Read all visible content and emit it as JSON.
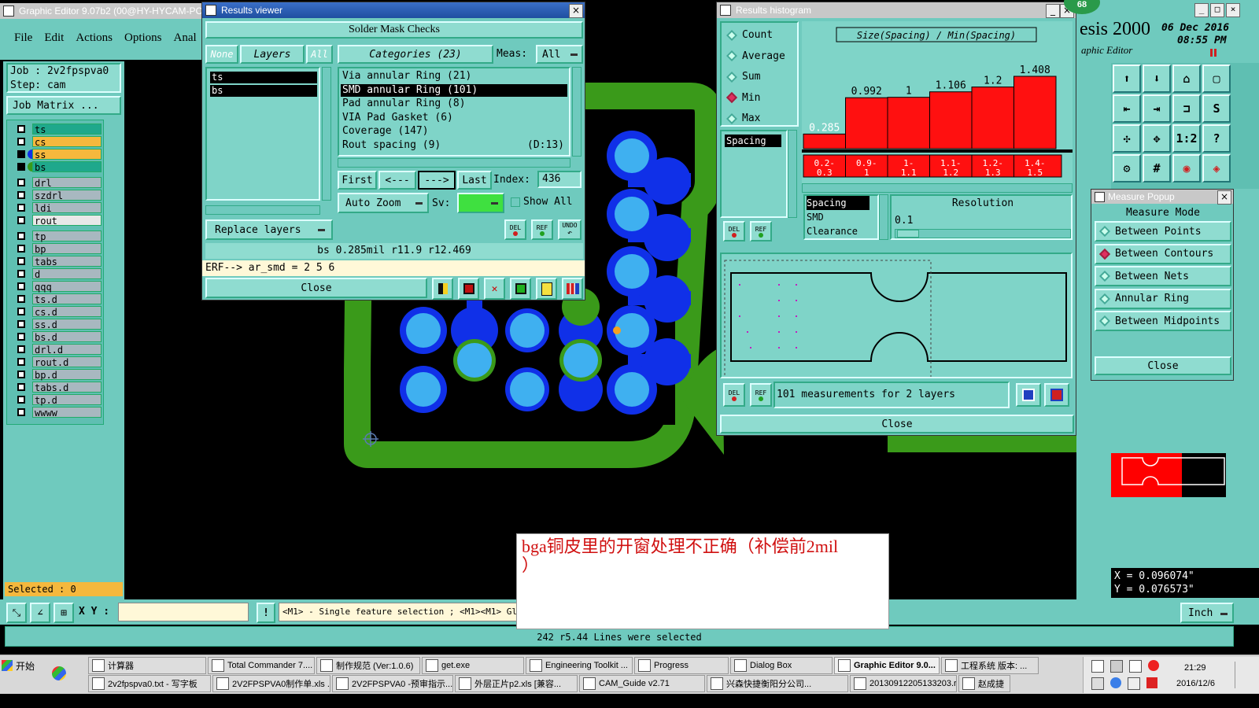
{
  "main_window": {
    "title": "Graphic Editor 9.07b2 (00@HY-HYCAM-PC",
    "menu": [
      "File",
      "Edit",
      "Actions",
      "Options",
      "Anal"
    ],
    "job_label": "Job : 2v2fpspva0",
    "step_label": "Step: cam",
    "job_matrix_button": "Job Matrix ...",
    "selected_label": "Selected : 0",
    "coord_label": "X Y :",
    "status_hint": "<M1> - Single feature selection ; <M1><M1> Gl",
    "units_button": "Inch",
    "status_bar": "242 r5.44 Lines were selected",
    "brand": "esis 2000",
    "brand_sub": "aphic Editor",
    "date": "06 Dec 2016",
    "time": "08:55 PM",
    "coord_x": "X = 0.096074\"",
    "coord_y": "Y = 0.076573\"",
    "badge": "68"
  },
  "layers_group1": [
    {
      "name": "ts",
      "color": "#1fa88c"
    },
    {
      "name": "cs",
      "color": "#f5b83d"
    },
    {
      "name": "ss",
      "color": "#f5b83d"
    },
    {
      "name": "bs",
      "color": "#1fa88c"
    }
  ],
  "layers_group2": [
    "drl",
    "szdrl",
    "ldi",
    "rout"
  ],
  "layers_group3": [
    "tp",
    "bp",
    "tabs",
    "d",
    "qqq",
    "ts.d",
    "cs.d",
    "ss.d",
    "bs.d",
    "drl.d",
    "rout.d",
    "bp.d",
    "tabs.d",
    "tp.d",
    "wwww"
  ],
  "results_viewer": {
    "title": "Results viewer",
    "heading": "Solder Mask Checks",
    "none_btn": "None",
    "layers_btn": "Layers",
    "all_btn": "All",
    "categories_label": "Categories (23)",
    "meas_label": "Meas:",
    "meas_value": "All",
    "layers": [
      "ts",
      "bs"
    ],
    "categories": [
      {
        "name": "Via annular Ring (21)",
        "extra": ""
      },
      {
        "name": "SMD annular Ring (101)",
        "extra": ""
      },
      {
        "name": "Pad annular Ring (8)",
        "extra": ""
      },
      {
        "name": "VIA Pad Gasket (6)",
        "extra": ""
      },
      {
        "name": "Coverage (147)",
        "extra": ""
      },
      {
        "name": "Rout spacing (9)",
        "extra": "(D:13)"
      }
    ],
    "first_btn": "First",
    "prev_btn": "<---",
    "next_btn": "--->",
    "last_btn": "Last",
    "index_label": "Index:",
    "index_value": "436",
    "auto_zoom_btn": "Auto Zoom",
    "sv_label": "Sv:",
    "show_all_label": "Show All",
    "replace_layers_btn": "Replace layers",
    "del_label": "DEL",
    "ref_label": "REF",
    "undo_label": "UNDO",
    "info_line": "bs 0.285mil   r11.9   r12.469",
    "erf_line": "ERF--> ar_smd = 2 5 6",
    "close_btn": "Close"
  },
  "histogram": {
    "title": "Results histogram",
    "modes": [
      "Count",
      "Average",
      "Sum",
      "Min",
      "Max"
    ],
    "selected_mode": "Min",
    "list_item": "Spacing",
    "chart_title": "Size(Spacing) / Min(Spacing)",
    "bars": [
      {
        "range": "0.2-0.3",
        "value": 0.285,
        "label": "0.285"
      },
      {
        "range": "0.9-1",
        "value": 0.992,
        "label": "0.992"
      },
      {
        "range": "1-1.1",
        "value": 1,
        "label": "1"
      },
      {
        "range": "1.1-1.2",
        "value": 1.106,
        "label": "1.106"
      },
      {
        "range": "1.2-1.3",
        "value": 1.2,
        "label": "1.2"
      },
      {
        "range": "1.4-1.5",
        "value": 1.408,
        "label": "1.408"
      }
    ],
    "range_labels": [
      "0.2-\n0.3",
      "0.9-\n1",
      "1-\n1.1",
      "1.1-\n1.2",
      "1.2-\n1.3",
      "1.4-\n1.5"
    ],
    "category_items": [
      "Spacing",
      "SMD",
      "Clearance"
    ],
    "resolution_label": "Resolution",
    "resolution_value": "0.1",
    "measurements_text": "101 measurements for 2 layers",
    "close_btn": "Close"
  },
  "measure_popup": {
    "title": "Measure Popup",
    "mode_label": "Measure Mode",
    "modes": [
      "Between Points",
      "Between Contours",
      "Between Nets",
      "Annular Ring",
      "Between Midpoints"
    ],
    "selected_mode": "Between Contours",
    "close_btn": "Close"
  },
  "annotation": {
    "text": "bga铜皮里的开窗处理不正确（补偿前2mil\n）"
  },
  "taskbar": {
    "start": "开始",
    "row1": [
      "计算器",
      "Total Commander 7....",
      "制作规范 (Ver:1.0.6)",
      "get.exe",
      "Engineering Toolkit ...",
      "Progress",
      "Dialog Box",
      "Graphic Editor 9.0...",
      "工程系统  版本: ..."
    ],
    "row2": [
      "2v2fpspva0.txt - 写字板",
      "2V2FPSPVA0制作单.xls ...",
      "2V2FPSPVA0 -预审指示...",
      "外层正片p2.xls [兼容...",
      "CAM_Guide v2.71",
      "兴森快捷衡阳分公司...",
      "20130912205133203.rt...",
      "赵成捷"
    ],
    "clock_time": "21:29",
    "clock_date": "2016/12/6"
  }
}
